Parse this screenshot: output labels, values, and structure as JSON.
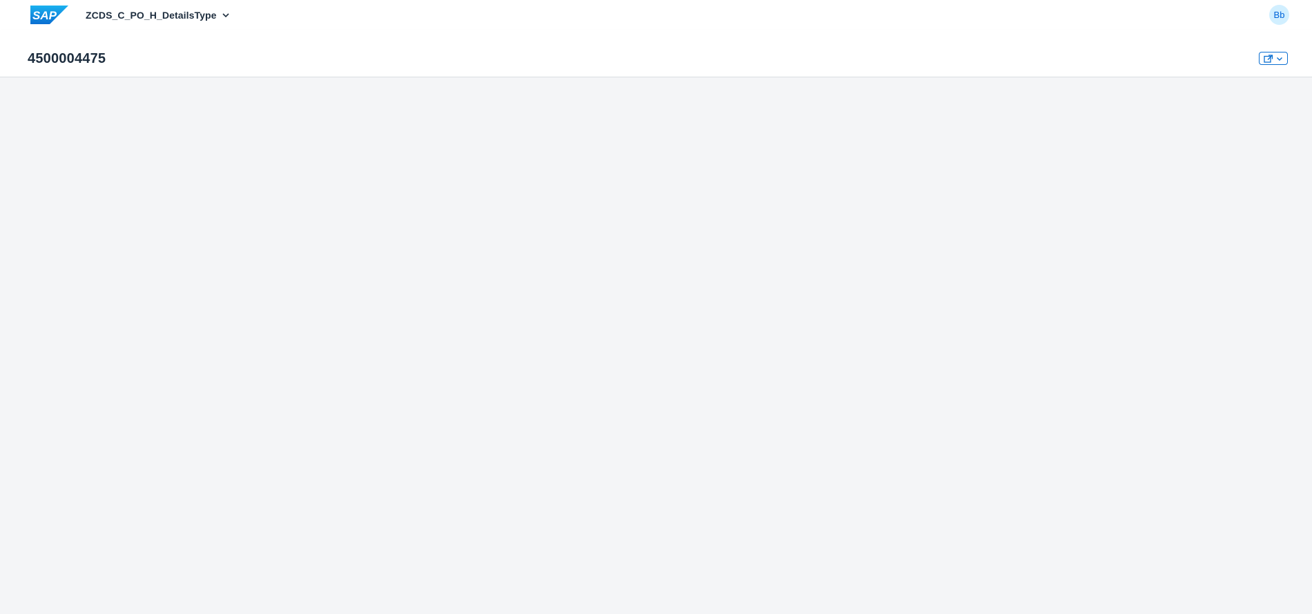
{
  "shellbar": {
    "logo_text": "SAP",
    "app_title": "ZCDS_C_PO_H_DetailsType",
    "avatar_initials": "Bb"
  },
  "object_header": {
    "title": "4500004475"
  },
  "icons": {
    "app_title_menu": "chevron-down-icon",
    "share": "share-icon",
    "share_menu": "chevron-down-icon"
  },
  "colors": {
    "brand_blue": "#0a6ed1",
    "avatar_bg": "#d1efff",
    "avatar_text": "#0064d9",
    "page_bg": "#f4f5f7"
  }
}
